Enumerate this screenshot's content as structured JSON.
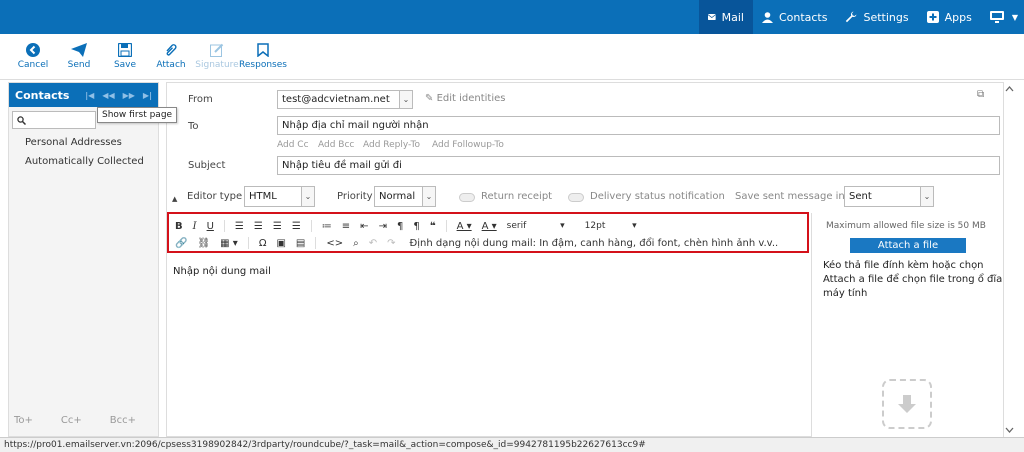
{
  "topnav": {
    "mail": "Mail",
    "contacts": "Contacts",
    "settings": "Settings",
    "apps": "Apps"
  },
  "toolbar": {
    "cancel": "Cancel",
    "send": "Send",
    "save": "Save",
    "attach": "Attach",
    "signature": "Signature",
    "responses": "Responses"
  },
  "left": {
    "title": "Contacts",
    "tooltip": "Show first page",
    "groups": [
      "Personal Addresses",
      "Automatically Collected"
    ],
    "footer": [
      "To+",
      "Cc+",
      "Bcc+"
    ]
  },
  "form": {
    "from_label": "From",
    "from_value": "test@adcvietnam.net",
    "edit_identities": "Edit identities",
    "to_label": "To",
    "to_value": "Nhập địa chỉ mail người nhận",
    "add_cc": "Add Cc",
    "add_bcc": "Add Bcc",
    "add_replyto": "Add Reply-To",
    "add_followup": "Add Followup-To",
    "subject_label": "Subject",
    "subject_value": "Nhập tiêu đề mail gửi đi",
    "editor_type_label": "Editor type",
    "editor_type_value": "HTML",
    "priority_label": "Priority",
    "priority_value": "Normal",
    "return_receipt": "Return receipt",
    "delivery_status": "Delivery status notification",
    "save_sent_label": "Save sent message in",
    "save_sent_value": "Sent"
  },
  "editor": {
    "font": "serif",
    "size": "12pt",
    "annotation": "Định dạng nội dung mail: In đậm, canh hàng, đổi font, chèn hình ảnh v.v..",
    "body": "Nhập nội dung mail"
  },
  "attach": {
    "max_size": "Maximum allowed file size is 50 MB",
    "button": "Attach a file",
    "hint": "Kéo thả file đính kèm hoặc chọn Attach a file để chọn file trong ổ đĩa máy tính"
  },
  "status_url": "https://pro01.emailserver.vn:2096/cpsess3198902842/3rdparty/roundcube/?_task=mail&_action=compose&_id=9942781195b22627613cc9#",
  "colors": {
    "brand": "#0b6fb8",
    "highlight_border": "#d4111a"
  }
}
